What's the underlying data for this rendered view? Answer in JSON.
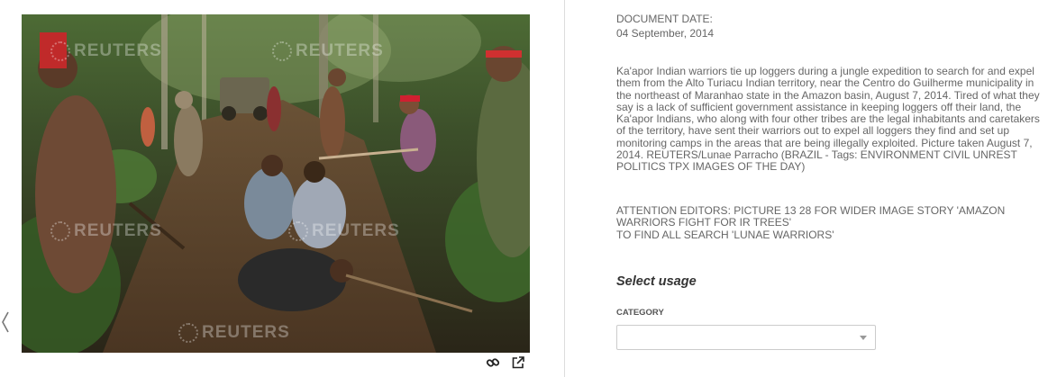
{
  "gallery": {
    "prev_icon": "chevron-left-icon",
    "watermark_text": "REUTERS",
    "tools": {
      "link_icon": "link-icon",
      "open_icon": "external-link-icon"
    }
  },
  "document": {
    "date_label": "DOCUMENT DATE:",
    "date_value": "04 September, 2014",
    "caption": "Ka'apor Indian warriors tie up loggers during a jungle expedition to search for and expel them from the Alto Turiacu Indian territory, near the Centro do Guilherme municipality in the northeast of Maranhao state in the Amazon basin, August 7, 2014. Tired of what they say is a lack of sufficient government assistance in keeping loggers off their land, the Ka'apor Indians, who along with four other tribes are the legal inhabitants and caretakers of the territory, have sent their warriors out to expel all loggers they find and set up monitoring camps in the areas that are being illegally exploited. Picture taken August 7, 2014. REUTERS/Lunae Parracho (BRAZIL - Tags: ENVIRONMENT CIVIL UNREST POLITICS TPX IMAGES OF THE DAY)",
    "editors_note_line1": "ATTENTION EDITORS: PICTURE 13 28 FOR WIDER IMAGE STORY 'AMAZON WARRIORS FIGHT FOR IR TREES'",
    "editors_note_line2": "TO FIND ALL SEARCH 'LUNAE WARRIORS'"
  },
  "usage": {
    "title": "Select usage",
    "category_label": "CATEGORY",
    "category_value": ""
  },
  "colors": {
    "text": "#666666",
    "heading": "#333333",
    "divider": "#dddddd",
    "select_border": "#cccccc"
  }
}
